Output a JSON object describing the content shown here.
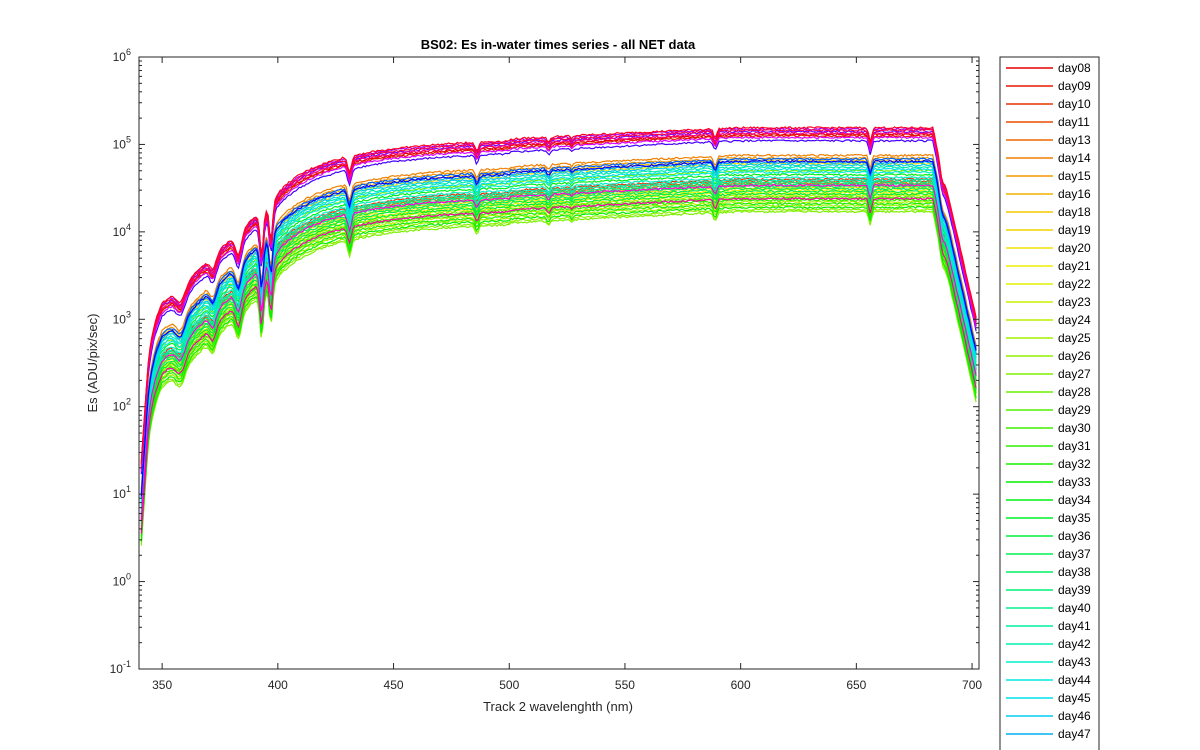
{
  "chart_data": {
    "type": "line",
    "title": "BS02: Es in-water times series - all NET data",
    "xlabel": "Track 2 wavelenghth (nm)",
    "ylabel": "Es (ADU/pix/sec)",
    "xlim": [
      340,
      703
    ],
    "ylim": [
      0.1,
      1000000
    ],
    "yscale": "log",
    "xticks": [
      350,
      400,
      450,
      500,
      550,
      600,
      650,
      700
    ],
    "yticks": [
      {
        "base": "10",
        "exp": "-1",
        "value": 0.1
      },
      {
        "base": "10",
        "exp": "0",
        "value": 1
      },
      {
        "base": "10",
        "exp": "1",
        "value": 10
      },
      {
        "base": "10",
        "exp": "2",
        "value": 100
      },
      {
        "base": "10",
        "exp": "3",
        "value": 1000
      },
      {
        "base": "10",
        "exp": "4",
        "value": 10000
      },
      {
        "base": "10",
        "exp": "5",
        "value": 100000
      },
      {
        "base": "10",
        "exp": "6",
        "value": 1000000
      }
    ],
    "grid": false,
    "legend_position": "outside-right",
    "series": [
      {
        "name": "day08",
        "color": "#e60000",
        "level": 130000
      },
      {
        "name": "day09",
        "color": "#e61a00",
        "level": 125000
      },
      {
        "name": "day10",
        "color": "#e83300",
        "level": 40000
      },
      {
        "name": "day11",
        "color": "#ea4c00",
        "level": 38000
      },
      {
        "name": "day13",
        "color": "#ee6600",
        "level": 36000
      },
      {
        "name": "day14",
        "color": "#f07f00",
        "level": 75000
      },
      {
        "name": "day15",
        "color": "#f29900",
        "level": 70000
      },
      {
        "name": "day16",
        "color": "#f4b200",
        "level": 34000
      },
      {
        "name": "day18",
        "color": "#f6c800",
        "level": 65000
      },
      {
        "name": "day19",
        "color": "#f4d400",
        "level": 32000
      },
      {
        "name": "day20",
        "color": "#f2e000",
        "level": 60000
      },
      {
        "name": "day21",
        "color": "#eeee00",
        "level": 30000
      },
      {
        "name": "day22",
        "color": "#e0f000",
        "level": 28000
      },
      {
        "name": "day23",
        "color": "#ccf000",
        "level": 26000
      },
      {
        "name": "day24",
        "color": "#b8f000",
        "level": 22000
      },
      {
        "name": "day25",
        "color": "#a4f000",
        "level": 20000
      },
      {
        "name": "day26",
        "color": "#90f000",
        "level": 18000
      },
      {
        "name": "day27",
        "color": "#7cf000",
        "level": 17000
      },
      {
        "name": "day28",
        "color": "#68f000",
        "level": 50000
      },
      {
        "name": "day29",
        "color": "#54f000",
        "level": 25000
      },
      {
        "name": "day30",
        "color": "#40f000",
        "level": 24000
      },
      {
        "name": "day31",
        "color": "#2cf000",
        "level": 23000
      },
      {
        "name": "day32",
        "color": "#18f000",
        "level": 21000
      },
      {
        "name": "day33",
        "color": "#04f000",
        "level": 19000
      },
      {
        "name": "day34",
        "color": "#00f014",
        "level": 45000
      },
      {
        "name": "day35",
        "color": "#00f028",
        "level": 27000
      },
      {
        "name": "day36",
        "color": "#00f03c",
        "level": 29000
      },
      {
        "name": "day37",
        "color": "#00f050",
        "level": 31000
      },
      {
        "name": "day38",
        "color": "#00f064",
        "level": 33000
      },
      {
        "name": "day39",
        "color": "#00f078",
        "level": 35000
      },
      {
        "name": "day40",
        "color": "#00f08c",
        "level": 37000
      },
      {
        "name": "day41",
        "color": "#00f0a0",
        "level": 55000
      },
      {
        "name": "day42",
        "color": "#00f0b4",
        "level": 39000
      },
      {
        "name": "day43",
        "color": "#00f0c8",
        "level": 42000
      },
      {
        "name": "day44",
        "color": "#00ecdc",
        "level": 48000
      },
      {
        "name": "day45",
        "color": "#00e0ee",
        "level": 52000
      },
      {
        "name": "day46",
        "color": "#00ccf2",
        "level": 58000
      },
      {
        "name": "day47",
        "color": "#00b0f4",
        "level": 62000
      }
    ],
    "hidden_series": [
      {
        "color": "#0060ff",
        "level": 68000
      },
      {
        "color": "#0000ff",
        "level": 64000
      },
      {
        "color": "#4400ff",
        "level": 110000
      },
      {
        "color": "#7700ff",
        "level": 140000
      },
      {
        "color": "#aa00ff",
        "level": 150000
      },
      {
        "color": "#dd00ff",
        "level": 120000
      },
      {
        "color": "#ff00dd",
        "level": 34000
      },
      {
        "color": "#ff00aa",
        "level": 24000
      },
      {
        "color": "#ff0077",
        "level": 135000
      },
      {
        "color": "#ff0044",
        "level": 145000
      },
      {
        "color": "#ff0022",
        "level": 155000
      }
    ]
  }
}
